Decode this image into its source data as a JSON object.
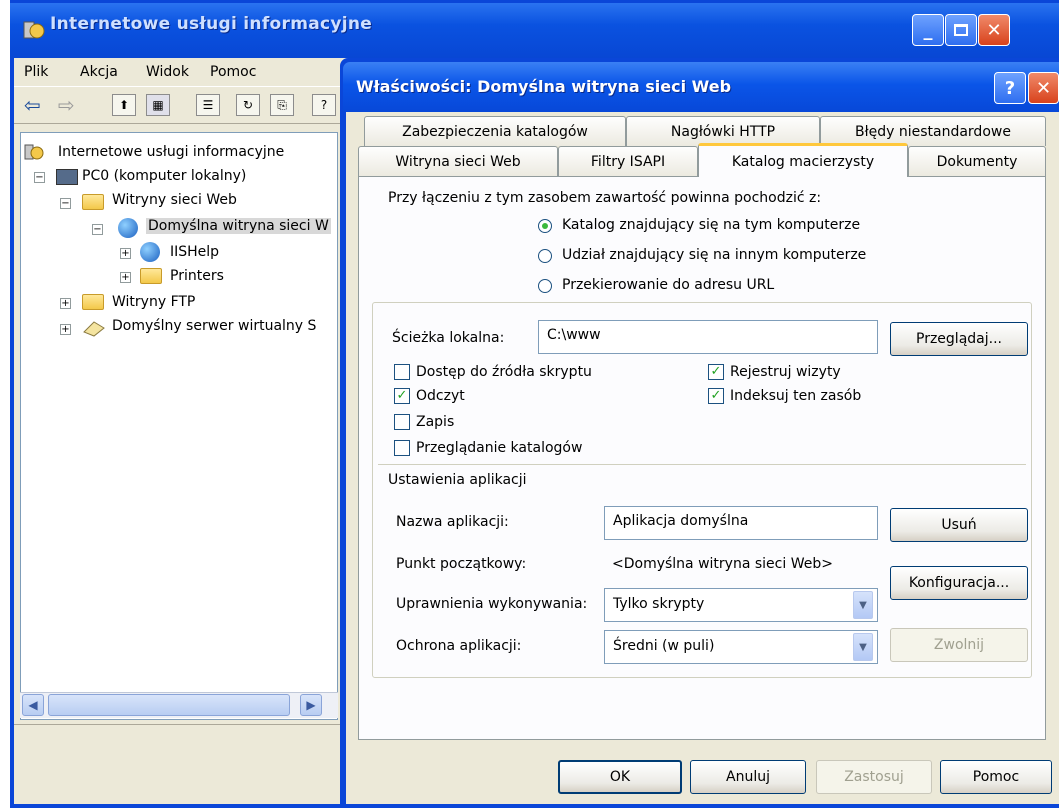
{
  "main_window": {
    "title": "Internetowe usługi informacyjne",
    "menu": [
      "Plik",
      "Akcja",
      "Widok",
      "Pomoc"
    ],
    "tree": [
      {
        "label": "Internetowe usługi informacyjne",
        "icon": "iis-icon"
      },
      {
        "label": "PC0 (komputer lokalny)",
        "icon": "computer-icon"
      },
      {
        "label": "Witryny sieci Web",
        "icon": "folder-icon"
      },
      {
        "label": "Domyślna witryna sieci W",
        "icon": "website-icon"
      },
      {
        "label": "IISHelp",
        "icon": "globe-icon"
      },
      {
        "label": "Printers",
        "icon": "folder-icon"
      },
      {
        "label": "Witryny FTP",
        "icon": "folder-icon"
      },
      {
        "label": "Domyślny serwer wirtualny S",
        "icon": "smtp-icon"
      }
    ]
  },
  "dialog": {
    "title": "Właściwości: Domyślna witryna sieci Web",
    "tabs_row1": [
      "Zabezpieczenia katalogów",
      "Nagłówki HTTP",
      "Błędy niestandardowe"
    ],
    "tabs_row2": [
      "Witryna sieci Web",
      "Filtry ISAPI",
      "Katalog macierzysty",
      "Dokumenty"
    ],
    "active_tab": "Katalog macierzysty",
    "source_prompt": "Przy łączeniu z tym zasobem zawartość powinna pochodzić z:",
    "source_options": [
      {
        "label": "Katalog znajdujący się na tym komputerze",
        "selected": true
      },
      {
        "label": "Udział znajdujący się na innym komputerze",
        "selected": false
      },
      {
        "label": "Przekierowanie do adresu URL",
        "selected": false
      }
    ],
    "local_path_label": "Ścieżka lokalna:",
    "local_path_value": "C:\\www",
    "browse_button": "Przeglądaj...",
    "checkboxes_left": [
      {
        "label": "Dostęp do źródła skryptu",
        "checked": false
      },
      {
        "label": "Odczyt",
        "checked": true
      },
      {
        "label": "Zapis",
        "checked": false
      },
      {
        "label": "Przeglądanie katalogów",
        "checked": false
      }
    ],
    "checkboxes_right": [
      {
        "label": "Rejestruj wizyty",
        "checked": true
      },
      {
        "label": "Indeksuj ten zasób",
        "checked": true
      }
    ],
    "app_settings_heading": "Ustawienia aplikacji",
    "app_name_label": "Nazwa aplikacji:",
    "app_name_value": "Aplikacja domyślna",
    "remove_button": "Usuń",
    "start_point_label": "Punkt początkowy:",
    "start_point_value": "<Domyślna witryna sieci Web>",
    "config_button": "Konfiguracja...",
    "exec_perm_label": "Uprawnienia wykonywania:",
    "exec_perm_value": "Tylko skrypty",
    "app_protection_label": "Ochrona aplikacji:",
    "app_protection_value": "Średni (w puli)",
    "unload_button": "Zwolnij",
    "ok_button": "OK",
    "cancel_button": "Anuluj",
    "apply_button": "Zastosuj",
    "help_button": "Pomoc"
  },
  "colors": {
    "title_blue": "#0a55e8",
    "dialog_face": "#ece9d8",
    "close_red": "#d8421c"
  }
}
